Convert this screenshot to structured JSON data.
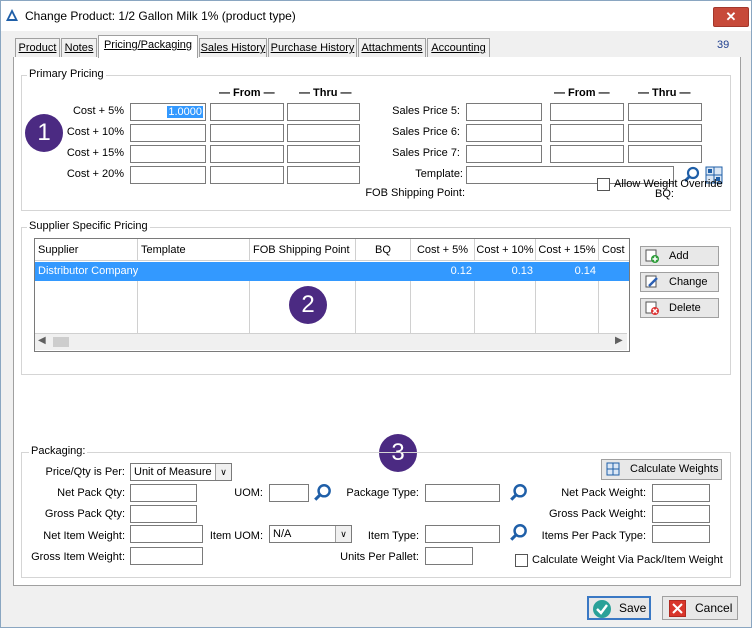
{
  "window": {
    "title": "Change Product: 1/2 Gallon Milk 1% (product type)",
    "close_glyph": "✕",
    "record_number": "39"
  },
  "tabs": [
    {
      "label": "Product"
    },
    {
      "label": "Notes"
    },
    {
      "label": "Pricing/Packaging"
    },
    {
      "label": "Sales History"
    },
    {
      "label": "Purchase History"
    },
    {
      "label": "Attachments"
    },
    {
      "label": "Accounting"
    }
  ],
  "active_tab": "Pricing/Packaging",
  "primary_pricing": {
    "group_label": "Primary Pricing",
    "from_header": "— From —",
    "thru_header": "— Thru —",
    "cost_rows": [
      {
        "label": "Cost + 5%",
        "value": "1.0000",
        "from": "",
        "thru": ""
      },
      {
        "label": "Cost + 10%",
        "value": "",
        "from": "",
        "thru": ""
      },
      {
        "label": "Cost + 15%",
        "value": "",
        "from": "",
        "thru": ""
      },
      {
        "label": "Cost + 20%",
        "value": "",
        "from": "",
        "thru": ""
      }
    ],
    "sales_rows": [
      {
        "label": "Sales Price 5:",
        "value": "",
        "from": "",
        "thru": ""
      },
      {
        "label": "Sales Price 6:",
        "value": "",
        "from": "",
        "thru": ""
      },
      {
        "label": "Sales Price 7:",
        "value": "",
        "from": "",
        "thru": ""
      }
    ],
    "template_label": "Template:",
    "template_value": "",
    "allow_weight_override_label": "Allow Weight Override",
    "fob_label": "FOB Shipping Point:",
    "bq_label": "BQ:"
  },
  "supplier_pricing": {
    "group_label": "Supplier Specific Pricing",
    "columns": [
      "Supplier",
      "Template",
      "FOB Shipping Point",
      "BQ",
      "Cost + 5%",
      "Cost + 10%",
      "Cost + 15%",
      "Cost"
    ],
    "rows": [
      {
        "supplier": "Distributor Company",
        "template": "",
        "fob": "",
        "bq": "",
        "c5": "0.12",
        "c10": "0.13",
        "c15": "0.14",
        "c20": ""
      }
    ],
    "add_label": "Add",
    "change_label": "Change",
    "delete_label": "Delete"
  },
  "packaging": {
    "group_label": "Packaging:",
    "price_qty_label": "Price/Qty is Per:",
    "price_qty_value": "Unit of Measure",
    "calc_weights_label": "Calculate Weights",
    "net_pack_qty_label": "Net Pack Qty:",
    "gross_pack_qty_label": "Gross Pack Qty:",
    "net_item_weight_label": "Net Item Weight:",
    "gross_item_weight_label": "Gross Item Weight:",
    "uom_label": "UOM:",
    "item_uom_label": "Item UOM:",
    "item_uom_value": "N/A",
    "package_type_label": "Package Type:",
    "item_type_label": "Item Type:",
    "units_per_pallet_label": "Units Per Pallet:",
    "net_pack_weight_label": "Net Pack Weight:",
    "gross_pack_weight_label": "Gross Pack Weight:",
    "items_per_pack_type_label": "Items Per Pack Type:",
    "calc_via_pack_label": "Calculate Weight Via Pack/Item Weight"
  },
  "annotations": [
    "1",
    "2",
    "3"
  ],
  "footer": {
    "save_label": "Save",
    "cancel_label": "Cancel"
  },
  "colors": {
    "selection": "#3399ff",
    "badge": "#4b2a82",
    "close": "#c74a3a"
  }
}
